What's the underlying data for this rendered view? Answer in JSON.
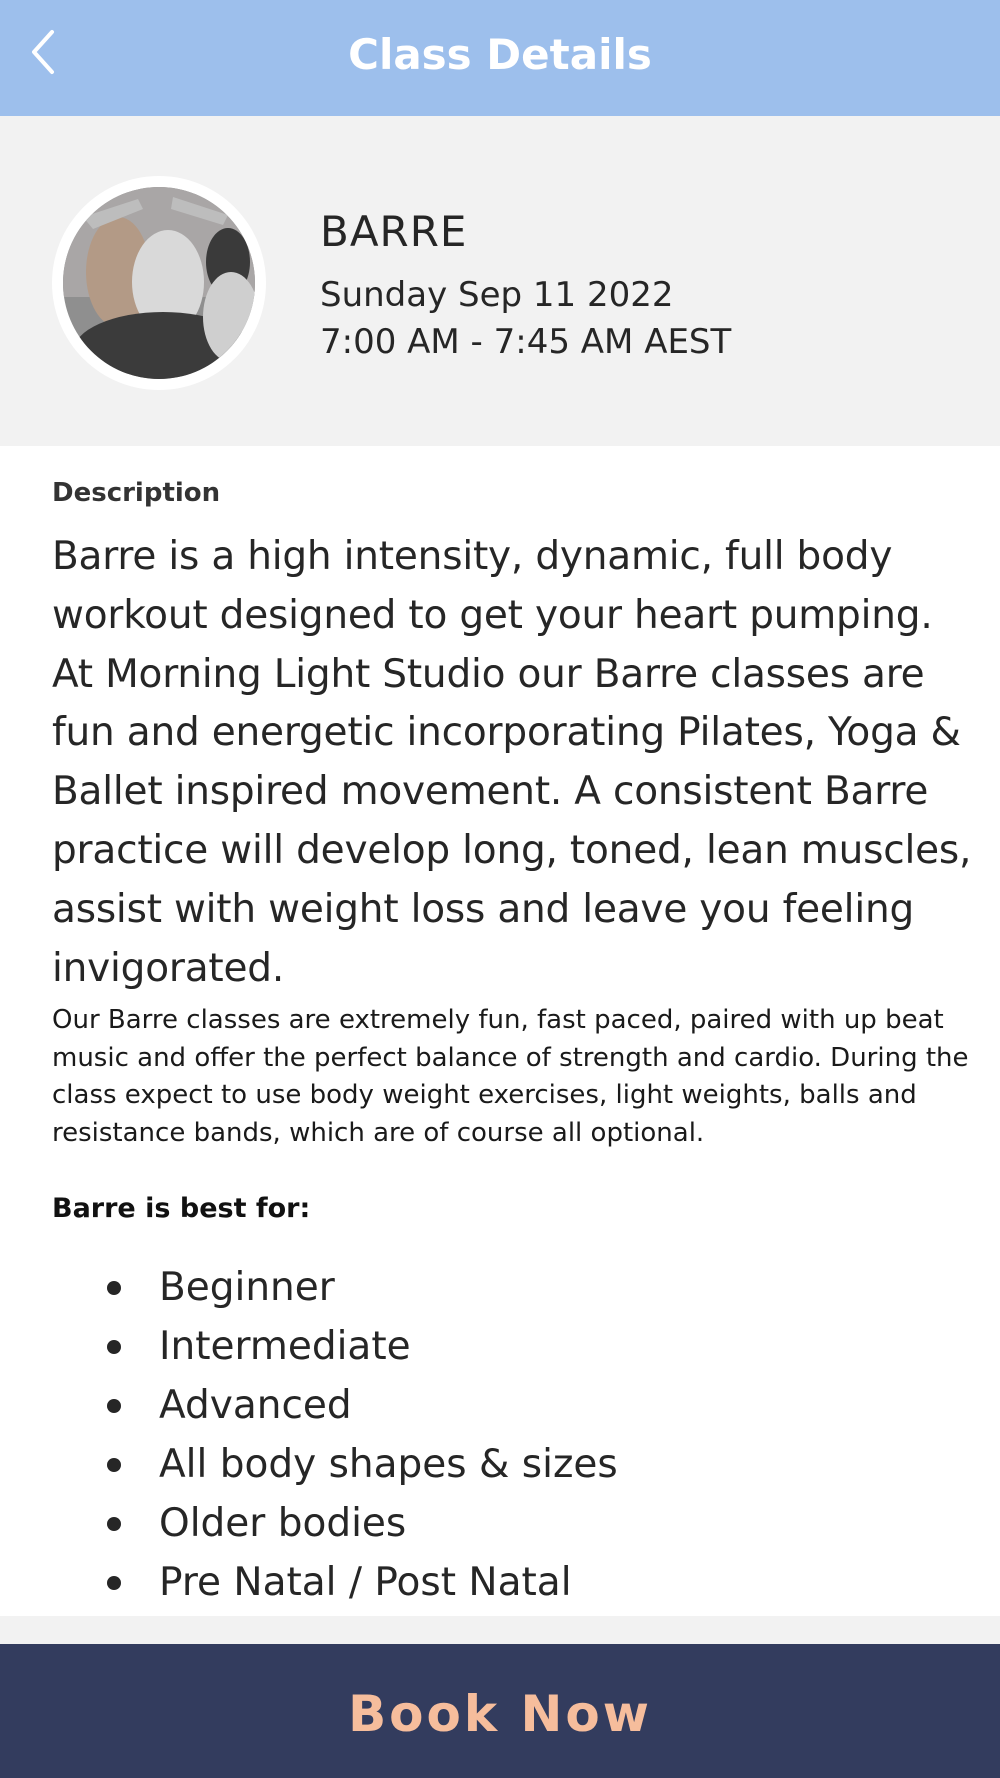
{
  "header": {
    "title": "Class Details",
    "back_icon": "chevron-left-icon"
  },
  "class": {
    "name": "BARRE",
    "date": "Sunday Sep 11 2022",
    "time": "7:00 AM - 7:45 AM AEST"
  },
  "description": {
    "label": "Description",
    "lead": "Barre is a high intensity, dynamic, full body workout designed to get your heart pumping. At Morning Light Studio our Barre classes are fun and energetic incorporating Pilates, Yoga & Ballet inspired movement. A consistent Barre practice will develop long, toned, lean muscles, assist with weight loss and leave you feeling invigorated.",
    "details": "Our Barre classes are extremely fun, fast paced, paired with up beat music and offer the perfect balance of strength and cardio. During the class expect to use body weight exercises, light weights, balls and resistance bands, which are of course all optional."
  },
  "best_for": {
    "label": "Barre is best for:",
    "items": [
      "Beginner",
      "Intermediate",
      "Advanced",
      "All body shapes & sizes",
      "Older bodies",
      "Pre Natal / Post Natal"
    ]
  },
  "actions": {
    "book_label": "Book Now"
  },
  "colors": {
    "header": "#9dbfec",
    "summary_bg": "#f2f2f2",
    "book_bg": "#333c5e",
    "book_text": "#f6bd9c"
  }
}
